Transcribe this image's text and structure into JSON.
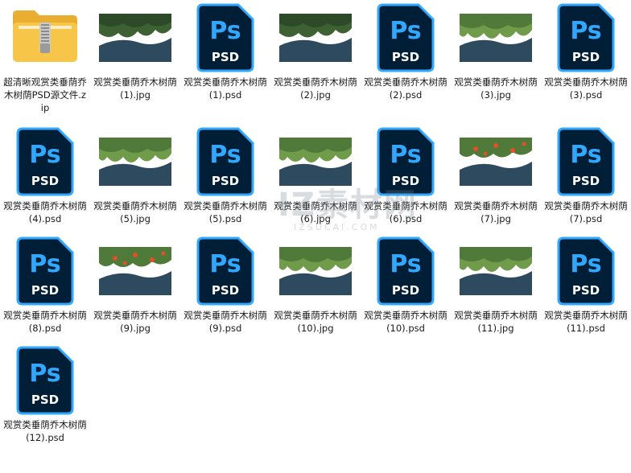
{
  "files": [
    {
      "type": "zip",
      "name": "超清晰观赏类垂荫乔木树荫PSD源文件.zip",
      "icon": "zip-folder-icon"
    },
    {
      "type": "jpg",
      "name": "观赏类垂荫乔木树荫 (1).jpg",
      "variant": "dark"
    },
    {
      "type": "psd",
      "name": "观赏类垂荫乔木树荫 (1).psd",
      "icon": "photoshop-psd-icon",
      "icon_text": "Ps",
      "icon_sub": "PSD"
    },
    {
      "type": "jpg",
      "name": "观赏类垂荫乔木树荫 (2).jpg",
      "variant": "dark"
    },
    {
      "type": "psd",
      "name": "观赏类垂荫乔木树荫 (2).psd",
      "icon": "photoshop-psd-icon",
      "icon_text": "Ps",
      "icon_sub": "PSD"
    },
    {
      "type": "jpg",
      "name": "观赏类垂荫乔木树荫 (3).jpg",
      "variant": "light"
    },
    {
      "type": "psd",
      "name": "观赏类垂荫乔木树荫 (3).psd",
      "icon": "photoshop-psd-icon",
      "icon_text": "Ps",
      "icon_sub": "PSD"
    },
    {
      "type": "psd",
      "name": "观赏类垂荫乔木树荫 (4).psd",
      "icon": "photoshop-psd-icon",
      "icon_text": "Ps",
      "icon_sub": "PSD"
    },
    {
      "type": "jpg",
      "name": "观赏类垂荫乔木树荫 (5).jpg",
      "variant": "light"
    },
    {
      "type": "psd",
      "name": "观赏类垂荫乔木树荫 (5).psd",
      "icon": "photoshop-psd-icon",
      "icon_text": "Ps",
      "icon_sub": "PSD"
    },
    {
      "type": "jpg",
      "name": "观赏类垂荫乔木树荫 (6).jpg",
      "variant": "light"
    },
    {
      "type": "psd",
      "name": "观赏类垂荫乔木树荫 (6).psd",
      "icon": "photoshop-psd-icon",
      "icon_text": "Ps",
      "icon_sub": "PSD"
    },
    {
      "type": "jpg",
      "name": "观赏类垂荫乔木树荫 (7).jpg",
      "variant": "flower"
    },
    {
      "type": "psd",
      "name": "观赏类垂荫乔木树荫 (7).psd",
      "icon": "photoshop-psd-icon",
      "icon_text": "Ps",
      "icon_sub": "PSD"
    },
    {
      "type": "psd",
      "name": "观赏类垂荫乔木树荫 (8).psd",
      "icon": "photoshop-psd-icon",
      "icon_text": "Ps",
      "icon_sub": "PSD"
    },
    {
      "type": "jpg",
      "name": "观赏类垂荫乔木树荫 (9).jpg",
      "variant": "flower"
    },
    {
      "type": "psd",
      "name": "观赏类垂荫乔木树荫 (9).psd",
      "icon": "photoshop-psd-icon",
      "icon_text": "Ps",
      "icon_sub": "PSD"
    },
    {
      "type": "jpg",
      "name": "观赏类垂荫乔木树荫 (10).jpg",
      "variant": "light"
    },
    {
      "type": "psd",
      "name": "观赏类垂荫乔木树荫 (10).psd",
      "icon": "photoshop-psd-icon",
      "icon_text": "Ps",
      "icon_sub": "PSD"
    },
    {
      "type": "jpg",
      "name": "观赏类垂荫乔木树荫 (11).jpg",
      "variant": "light"
    },
    {
      "type": "psd",
      "name": "观赏类垂荫乔木树荫 (11).psd",
      "icon": "photoshop-psd-icon",
      "icon_text": "Ps",
      "icon_sub": "PSD"
    },
    {
      "type": "psd",
      "name": "观赏类垂荫乔木树荫 (12).psd",
      "icon": "photoshop-psd-icon",
      "icon_text": "Ps",
      "icon_sub": "PSD"
    }
  ],
  "watermark": {
    "big": "IZ素材网",
    "small": "IZSUCAI.COM"
  },
  "colors": {
    "psd_bg": "#001e36",
    "psd_accent": "#31a8ff",
    "folder": "#f7c548",
    "jpg_ground": "#2e4a5f",
    "foliage": "#4f7a3a"
  }
}
